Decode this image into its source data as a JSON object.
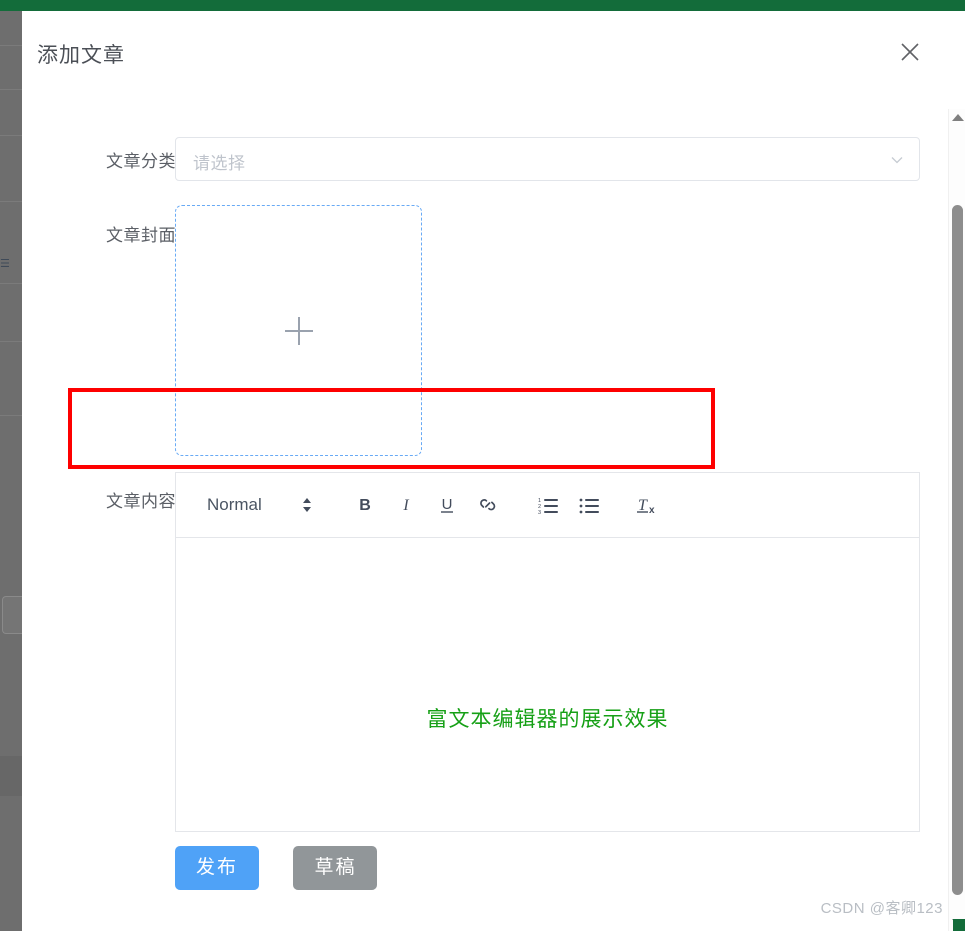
{
  "app": {
    "topbar_color": "#136c3a"
  },
  "dialog": {
    "title": "添加文章",
    "close_icon": "close-icon"
  },
  "form": {
    "category": {
      "label": "文章分类",
      "placeholder": "请选择",
      "value": "",
      "caret_icon": "chevron-down-icon"
    },
    "cover": {
      "label": "文章封面",
      "upload_icon": "plus-icon"
    },
    "content": {
      "label": "文章内容",
      "editor_text": "富文本编辑器的展示效果",
      "editor_text_color": "#16a016"
    }
  },
  "toolbar": {
    "format_label": "Normal",
    "format_arrows_icon": "updown-arrows-icon",
    "buttons": [
      {
        "name": "bold-icon",
        "label": "B"
      },
      {
        "name": "italic-icon",
        "label": "I"
      },
      {
        "name": "underline-icon",
        "label": "U"
      },
      {
        "name": "link-icon",
        "label": ""
      },
      {
        "name": "ordered-list-icon",
        "label": ""
      },
      {
        "name": "bullet-list-icon",
        "label": ""
      },
      {
        "name": "clear-format-icon",
        "label": "Tx"
      }
    ]
  },
  "footer": {
    "publish_label": "发布",
    "publish_color": "#4fa2f7",
    "draft_label": "草稿",
    "draft_color": "#919699"
  },
  "watermark": {
    "text": "CSDN @客卿123"
  },
  "annotation": {
    "color": "#fe0000"
  },
  "scrollbar": {
    "up_arrow_icon": "scroll-up-arrow-icon",
    "down_arrow_icon": "scroll-down-arrow-icon",
    "thumb_icon": "scrollbar-thumb"
  }
}
